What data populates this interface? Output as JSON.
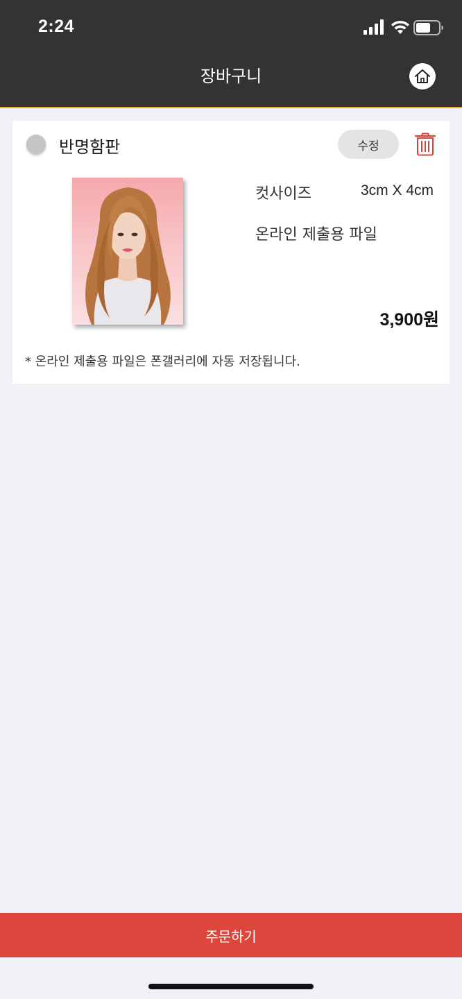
{
  "status_bar": {
    "time": "2:24"
  },
  "header": {
    "title": "장바구니"
  },
  "cart_item": {
    "name": "반명함판",
    "edit_label": "수정",
    "option_label": "컷사이즈",
    "option_value": "3cm X 4cm",
    "file_type": "온라인 제출용 파일",
    "price": "3,900원",
    "notice": "* 온라인 제출용 파일은 폰갤러리에 자동 저장됩니다."
  },
  "footer": {
    "order_label": "주문하기"
  },
  "colors": {
    "header_bg": "#333333",
    "accent_line": "#e9b22f",
    "order_button": "#dd463c",
    "delete_icon": "#d9443a",
    "background": "#f1f1f7"
  },
  "icons": {
    "signal": "cellular-signal-icon",
    "wifi": "wifi-icon",
    "battery": "battery-icon",
    "home": "home-icon",
    "delete": "trash-icon"
  }
}
